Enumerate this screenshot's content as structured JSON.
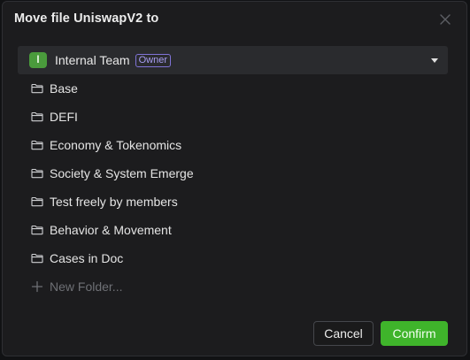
{
  "dialog": {
    "title": "Move file UniswapV2 to",
    "close_icon": "close-icon"
  },
  "team": {
    "avatar_letter": "I",
    "name": "Internal Team",
    "badge": "Owner",
    "avatar_color": "#4a9b3c",
    "badge_color": "#a79cf0",
    "caret_icon": "caret-down-icon"
  },
  "folders": [
    {
      "label": "Base",
      "icon": "folder-icon"
    },
    {
      "label": "DEFI",
      "icon": "folder-icon"
    },
    {
      "label": "Economy & Tokenomics",
      "icon": "folder-icon"
    },
    {
      "label": "Society & System Emerge",
      "icon": "folder-icon"
    },
    {
      "label": "Test freely by members",
      "icon": "folder-icon"
    },
    {
      "label": "Behavior & Movement",
      "icon": "folder-icon"
    },
    {
      "label": "Cases in Doc",
      "icon": "folder-icon"
    }
  ],
  "new_folder": {
    "label": "New Folder...",
    "icon": "plus-icon"
  },
  "actions": {
    "cancel_label": "Cancel",
    "confirm_label": "Confirm",
    "confirm_color": "#3fb42b"
  }
}
